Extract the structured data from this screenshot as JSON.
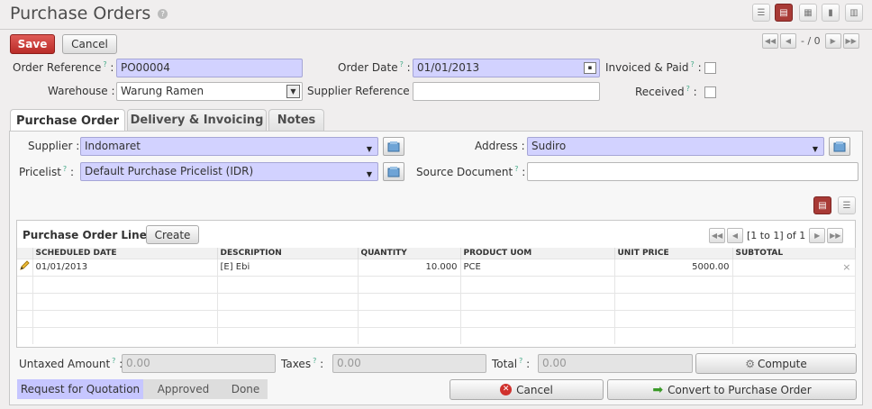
{
  "page": {
    "title": "Purchase Orders",
    "help_mark": "?"
  },
  "toolbar": {
    "save_label": "Save",
    "cancel_label": "Cancel",
    "pager_text": "- / 0"
  },
  "header_fields": {
    "order_reference": {
      "label": "Order Reference",
      "value": "PO00004"
    },
    "order_date": {
      "label": "Order Date",
      "value": "01/01/2013"
    },
    "invoiced_paid": {
      "label": "Invoiced & Paid",
      "checked": false
    },
    "warehouse": {
      "label": "Warehouse :",
      "value": "Warung Ramen"
    },
    "supplier_reference": {
      "label": "Supplier Reference :",
      "value": ""
    },
    "received": {
      "label": "Received",
      "checked": false
    }
  },
  "tabs": [
    {
      "label": "Purchase Order",
      "active": true
    },
    {
      "label": "Delivery & Invoicing",
      "active": false
    },
    {
      "label": "Notes",
      "active": false
    }
  ],
  "po_fields": {
    "supplier": {
      "label": "Supplier :",
      "value": "Indomaret"
    },
    "address": {
      "label": "Address :",
      "value": "Sudiro"
    },
    "pricelist": {
      "label": "Pricelist",
      "value": "Default Purchase Pricelist (IDR)"
    },
    "source_document": {
      "label": "Source Document",
      "value": ""
    }
  },
  "lines": {
    "title": "Purchase Order Lines",
    "create_label": "Create",
    "pager_text": "[1 to 1] of 1",
    "columns": [
      "SCHEDULED DATE",
      "DESCRIPTION",
      "QUANTITY",
      "PRODUCT UOM",
      "UNIT PRICE",
      "SUBTOTAL"
    ],
    "rows": [
      {
        "scheduled_date": "01/01/2013",
        "description": "[E] Ebi",
        "quantity": "10.000",
        "uom": "PCE",
        "unit_price": "5000.00",
        "subtotal": ""
      }
    ],
    "delete_glyph": "×"
  },
  "totals": {
    "untaxed": {
      "label": "Untaxed Amount",
      "value": "0.00"
    },
    "taxes": {
      "label": "Taxes",
      "value": "0.00"
    },
    "total": {
      "label": "Total",
      "value": "0.00"
    },
    "compute_label": "Compute"
  },
  "workflow": {
    "states": [
      "Request for Quotation",
      "Approved",
      "Done"
    ],
    "current": "Request for Quotation"
  },
  "actions": {
    "cancel_label": "Cancel",
    "convert_label": "Convert to Purchase Order"
  },
  "colors": {
    "save": "#b92c28",
    "required_field": "#d2d2ff",
    "active_view": "#a83a36",
    "status_active": "#c6c6ff"
  }
}
